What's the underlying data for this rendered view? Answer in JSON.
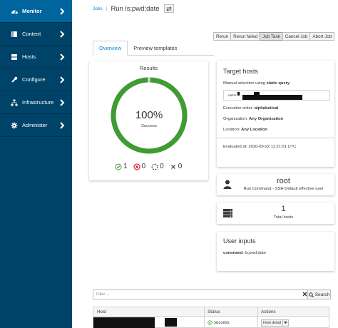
{
  "sidebar": {
    "items": [
      {
        "label": "Monitor",
        "icon": "tachometer-icon"
      },
      {
        "label": "Content",
        "icon": "book-icon"
      },
      {
        "label": "Hosts",
        "icon": "server-icon"
      },
      {
        "label": "Configure",
        "icon": "wrench-icon"
      },
      {
        "label": "Infrastructure",
        "icon": "network-icon"
      },
      {
        "label": "Administer",
        "icon": "gear-icon"
      }
    ],
    "active": "Monitor"
  },
  "breadcrumb": {
    "parent": "Jobs",
    "title": "Run ls;pwd;date"
  },
  "actions": [
    "Rerun",
    "Rerun failed",
    "Job Task",
    "Cancel Job",
    "Abort Job"
  ],
  "tabs": [
    "Overview",
    "Preview templates"
  ],
  "results": {
    "title": "Results",
    "percent": "100%",
    "status": "Success",
    "success_fraction": 1.0,
    "counts": {
      "success": "1",
      "failed": "0",
      "pending": "0",
      "cancelled": "0"
    }
  },
  "target_hosts": {
    "title": "Target hosts",
    "selection_prefix": "Manual selection using ",
    "selection_value": "static query",
    "query_label": "name",
    "execution_prefix": "Execution order: ",
    "execution_value": "alphabetical",
    "organization_prefix": "Organization: ",
    "organization_value": "Any Organization",
    "location_prefix": "Location: ",
    "location_value": "Any Location",
    "evaluated": "Evaluated at: 2020-09-22 11:21:01 UTC"
  },
  "user": {
    "name": "root",
    "subtitle": "Run Command - SSH Default effective user"
  },
  "hosts_total": {
    "count": "1",
    "label": "Total hosts"
  },
  "user_inputs": {
    "title": "User inputs",
    "key": "command",
    "value": "ls;pwd;date"
  },
  "filter": {
    "placeholder": "Filter ...",
    "search_label": "Search"
  },
  "table": {
    "columns": [
      "Host",
      "Status",
      "Actions"
    ],
    "rows": [
      {
        "status": "success",
        "action": "Host detail"
      }
    ]
  },
  "colors": {
    "sidebar": "#004368",
    "sidebar_active": "#00659c",
    "success": "#3f9c35",
    "link": "#0088ce",
    "danger": "#cc0000"
  }
}
